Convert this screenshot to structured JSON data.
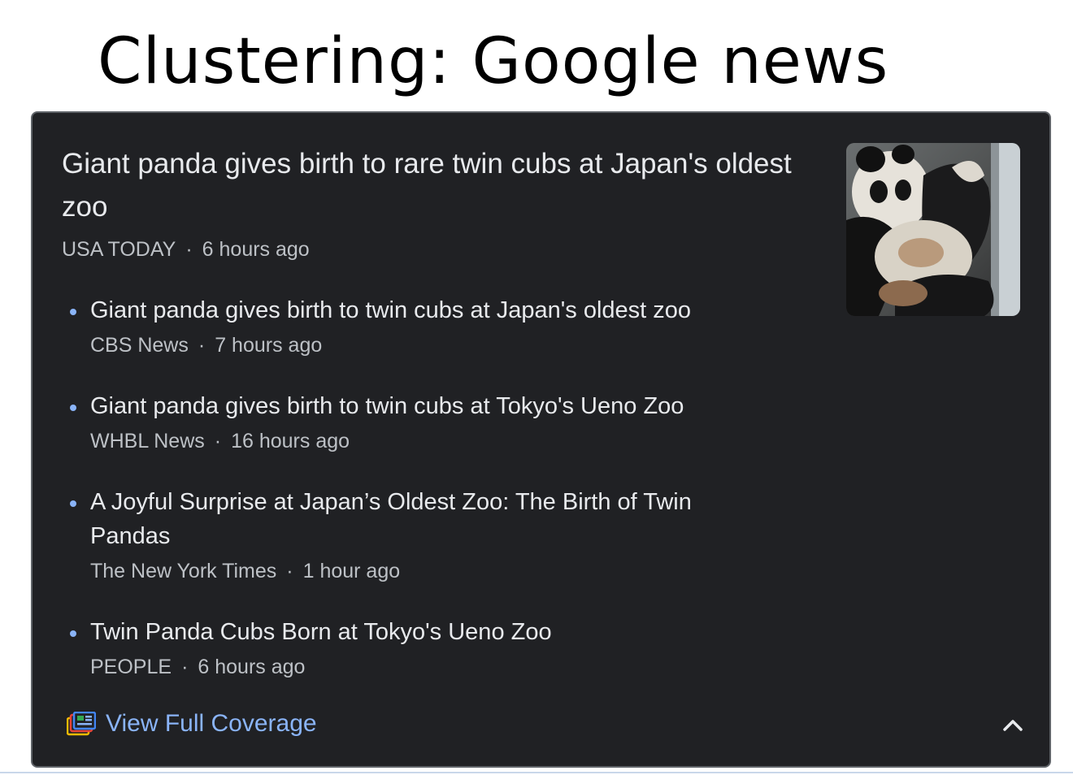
{
  "slide": {
    "title": "Clustering: Google news"
  },
  "lead": {
    "title": "Giant panda gives birth to rare twin cubs at Japan's oldest zoo",
    "source": "USA TODAY",
    "time": "6 hours ago",
    "thumbnail_alt": "panda"
  },
  "separator": "·",
  "stories": [
    {
      "title": "Giant panda gives birth to twin cubs at Japan's oldest zoo",
      "source": "CBS News",
      "time": "7 hours ago"
    },
    {
      "title": "Giant panda gives birth to twin cubs at Tokyo's Ueno Zoo",
      "source": "WHBL News",
      "time": "16 hours ago"
    },
    {
      "title": "A Joyful Surprise at Japan’s Oldest Zoo: The Birth of Twin Pandas",
      "source": "The New York Times",
      "time": "1 hour ago"
    },
    {
      "title": "Twin Panda Cubs Born at Tokyo's Ueno Zoo",
      "source": "PEOPLE",
      "time": "6 hours ago"
    }
  ],
  "footer": {
    "coverage_label": "View Full Coverage",
    "coverage_icon": "full-coverage-icon",
    "collapse_icon": "chevron-up-icon"
  },
  "colors": {
    "card_background": "#202124",
    "link": "#8ab4f8",
    "headline": "#e8eaed",
    "meta": "#bdc1c6"
  }
}
